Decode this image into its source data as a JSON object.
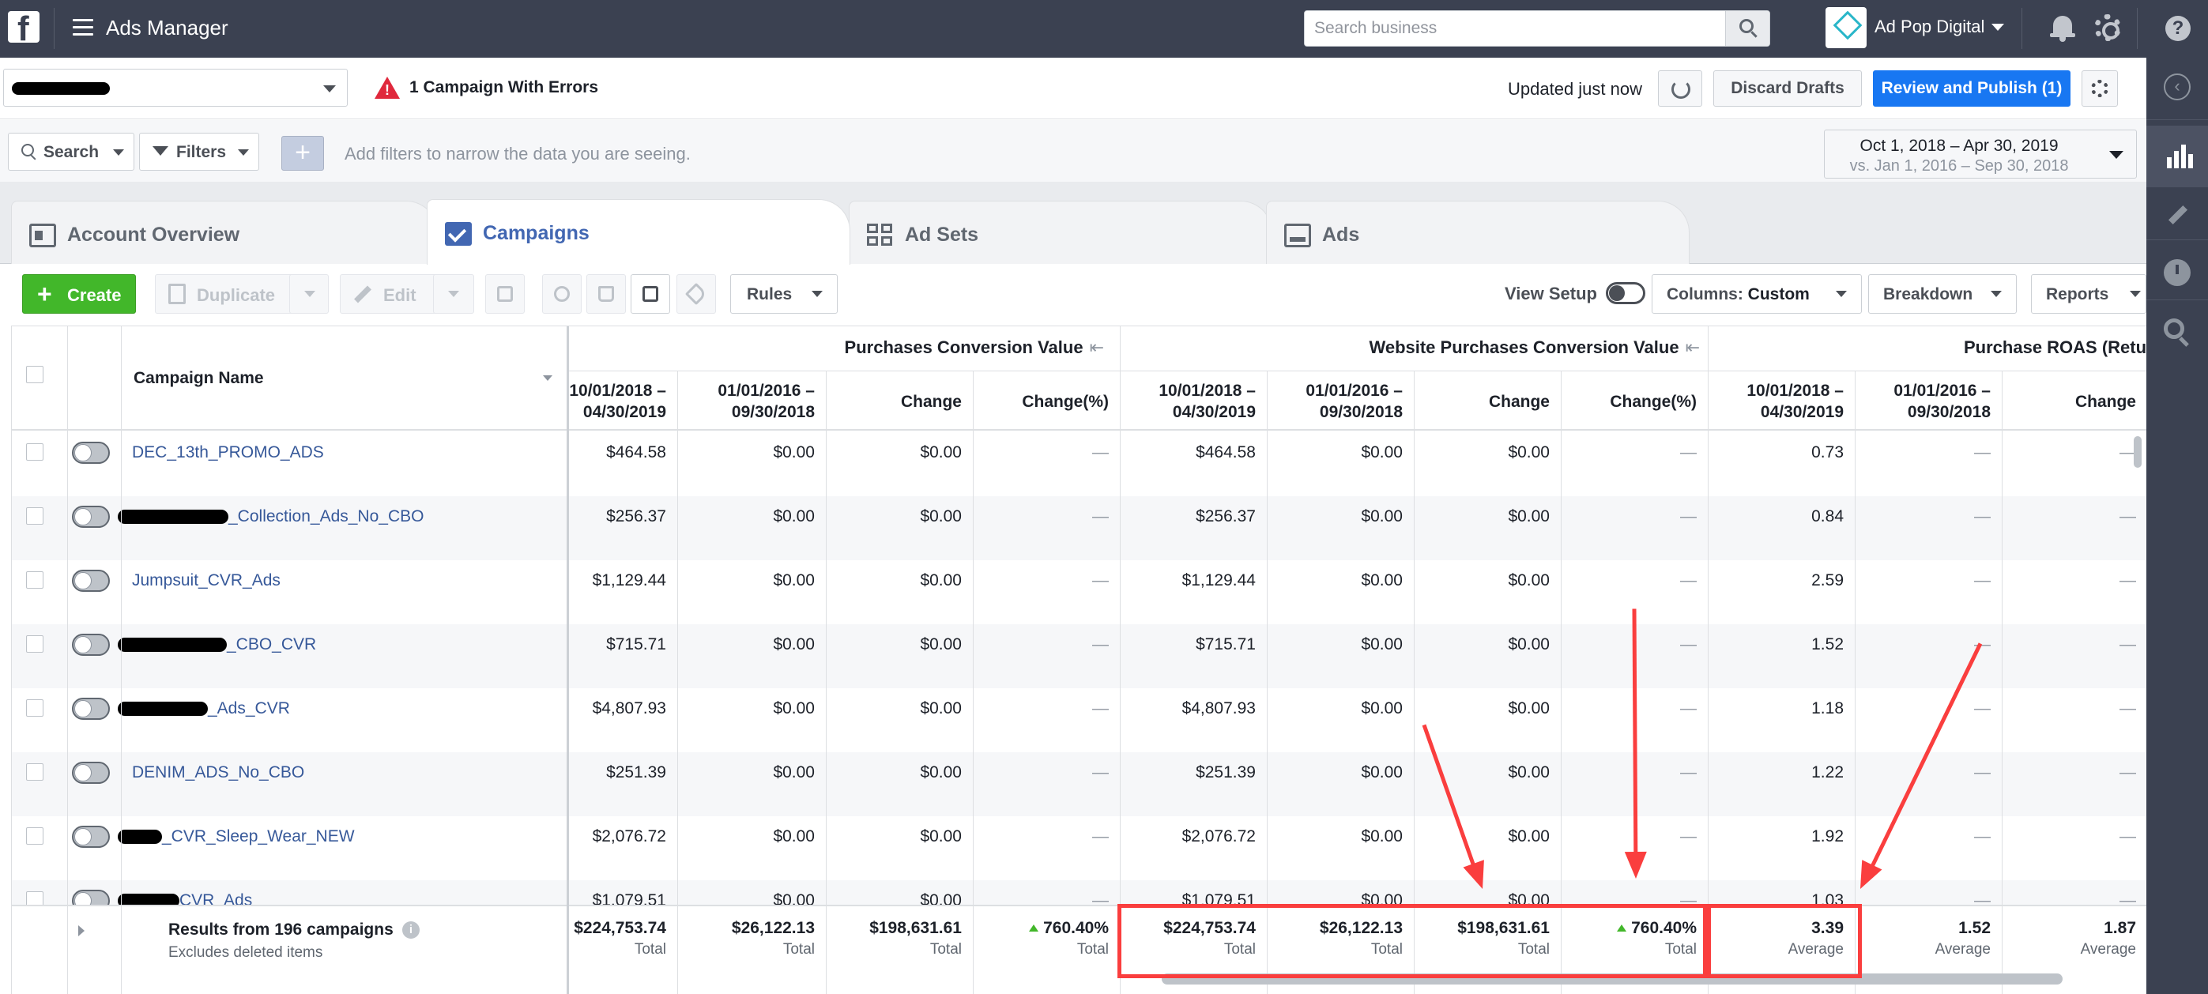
{
  "topbar": {
    "app_title": "Ads Manager",
    "search_placeholder": "Search business",
    "account_name": "Ad Pop Digital",
    "help_glyph": "?"
  },
  "row2": {
    "errors_text": "1 Campaign With Errors",
    "updated_text": "Updated just now",
    "discard_label": "Discard Drafts",
    "publish_label": "Review and Publish (1)"
  },
  "filters": {
    "search_label": "Search",
    "filters_label": "Filters",
    "add_label": "+",
    "hint": "Add filters to narrow the data you are seeing.",
    "date_main": "Oct 1, 2018 – Apr 30, 2019",
    "date_compare": "vs. Jan 1, 2016 – Sep 30, 2018"
  },
  "tabs": [
    {
      "label": "Account Overview",
      "icon": "account-overview-icon"
    },
    {
      "label": "Campaigns",
      "icon": "campaigns-icon"
    },
    {
      "label": "Ad Sets",
      "icon": "ad-sets-icon"
    },
    {
      "label": "Ads",
      "icon": "ads-icon"
    }
  ],
  "toolbar": {
    "create_label": "Create",
    "duplicate_label": "Duplicate",
    "edit_label": "Edit",
    "rules_label": "Rules",
    "view_setup_label": "View Setup",
    "columns_prefix": "Columns:",
    "columns_value": "Custom",
    "breakdown_label": "Breakdown",
    "reports_label": "Reports"
  },
  "table": {
    "name_header": "Campaign Name",
    "groups": [
      {
        "label": "Purchases Conversion Value"
      },
      {
        "label": "Website Purchases Conversion Value"
      },
      {
        "label": "Purchase ROAS (Return"
      }
    ],
    "sub_headers": [
      "10/01/2018 –\n04/30/2019",
      "01/01/2016 –\n09/30/2018",
      "Change",
      "Change(%)"
    ],
    "pin_glyph": "⇤",
    "rows": [
      {
        "name": "DEC_13th_PROMO_ADS",
        "redact": 0,
        "pcv": [
          "$464.58",
          "$0.00",
          "$0.00",
          "—"
        ],
        "wpcv": [
          "$464.58",
          "$0.00",
          "$0.00",
          "—"
        ],
        "roas": [
          "0.73",
          "—",
          "—"
        ]
      },
      {
        "name": "_Collection_Ads_No_CBO",
        "redact": 140,
        "pcv": [
          "$256.37",
          "$0.00",
          "$0.00",
          "—"
        ],
        "wpcv": [
          "$256.37",
          "$0.00",
          "$0.00",
          "—"
        ],
        "roas": [
          "0.84",
          "—",
          "—"
        ]
      },
      {
        "name": "Jumpsuit_CVR_Ads",
        "redact": 0,
        "pcv": [
          "$1,129.44",
          "$0.00",
          "$0.00",
          "—"
        ],
        "wpcv": [
          "$1,129.44",
          "$0.00",
          "$0.00",
          "—"
        ],
        "roas": [
          "2.59",
          "—",
          "—"
        ]
      },
      {
        "name": "_CBO_CVR",
        "redact": 138,
        "pcv": [
          "$715.71",
          "$0.00",
          "$0.00",
          "—"
        ],
        "wpcv": [
          "$715.71",
          "$0.00",
          "$0.00",
          "—"
        ],
        "roas": [
          "1.52",
          "—",
          "—"
        ]
      },
      {
        "name": "_Ads_CVR",
        "redact": 114,
        "pcv": [
          "$4,807.93",
          "$0.00",
          "$0.00",
          "—"
        ],
        "wpcv": [
          "$4,807.93",
          "$0.00",
          "$0.00",
          "—"
        ],
        "roas": [
          "1.18",
          "—",
          "—"
        ]
      },
      {
        "name": "DENIM_ADS_No_CBO",
        "redact": 0,
        "pcv": [
          "$251.39",
          "$0.00",
          "$0.00",
          "—"
        ],
        "wpcv": [
          "$251.39",
          "$0.00",
          "$0.00",
          "—"
        ],
        "roas": [
          "1.22",
          "—",
          "—"
        ]
      },
      {
        "name": "_CVR_Sleep_Wear_NEW",
        "redact": 56,
        "pcv": [
          "$2,076.72",
          "$0.00",
          "$0.00",
          "—"
        ],
        "wpcv": [
          "$2,076.72",
          "$0.00",
          "$0.00",
          "—"
        ],
        "roas": [
          "1.92",
          "—",
          "—"
        ]
      },
      {
        "name": "CVR_Ads",
        "redact": 78,
        "pcv": [
          "$1,079.51",
          "$0.00",
          "$0.00",
          "—"
        ],
        "wpcv": [
          "$1,079.51",
          "$0.00",
          "$0.00",
          "—"
        ],
        "roas": [
          "1.03",
          "—",
          "—"
        ]
      }
    ],
    "footer": {
      "title": "Results from 196 campaigns",
      "subtitle": "Excludes deleted items",
      "pcv": [
        "$224,753.74",
        "$26,122.13",
        "$198,631.61",
        "760.40%"
      ],
      "wpcv": [
        "$224,753.74",
        "$26,122.13",
        "$198,631.61",
        "760.40%"
      ],
      "roas": [
        "3.39",
        "1.52",
        "1.87"
      ],
      "total_label": "Total",
      "average_label": "Average"
    }
  },
  "colors": {
    "topbar": "#3b4151",
    "accent_blue": "#1877f2",
    "create_green": "#42b72a",
    "link": "#365899",
    "annotation_red": "#fa3e3e"
  }
}
